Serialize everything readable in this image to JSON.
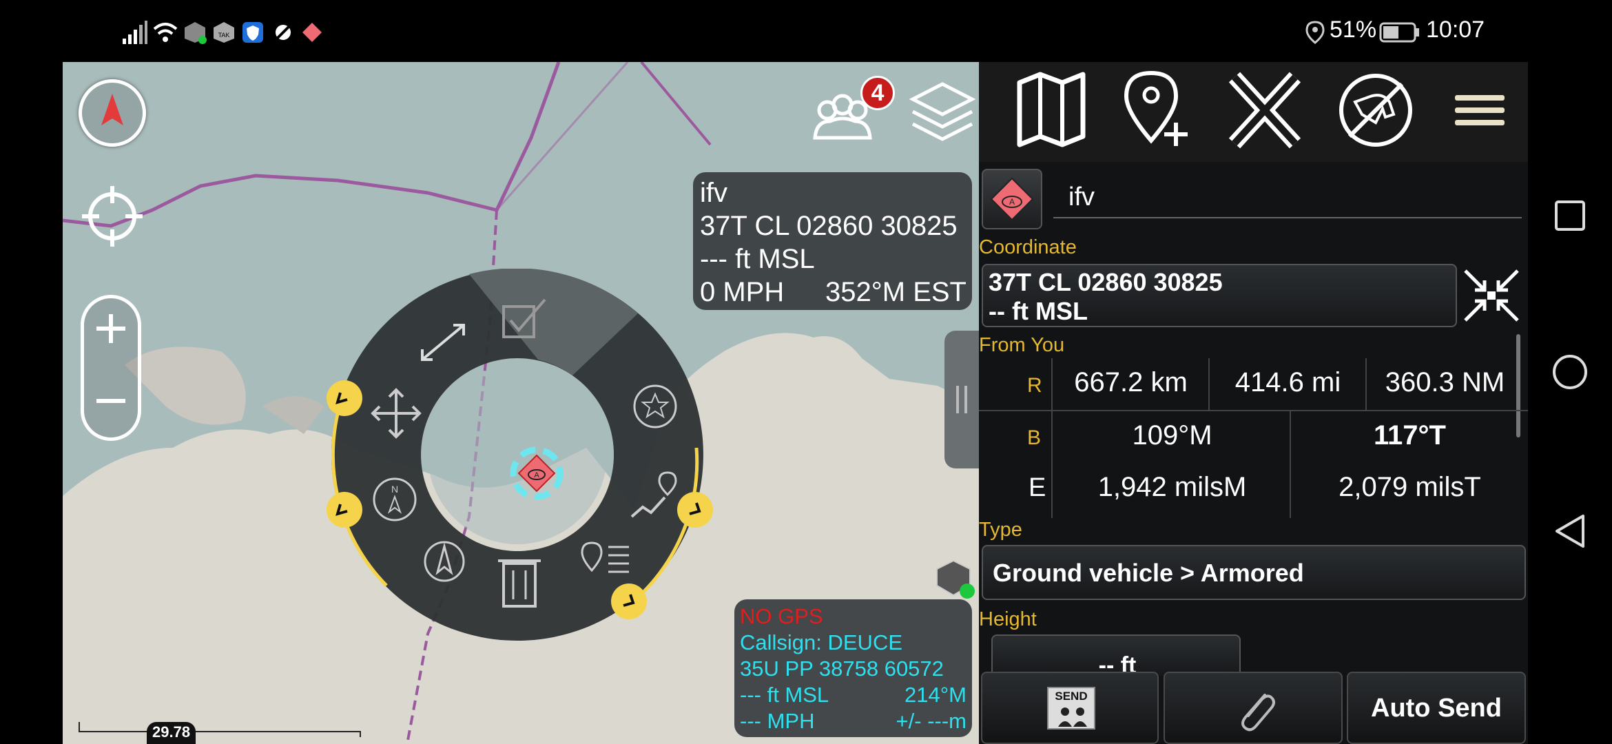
{
  "status_bar": {
    "battery_pct": "51%",
    "time": "10:07"
  },
  "map": {
    "selected_info": {
      "name": "ifv",
      "coordinate": "37T CL 02860 30825",
      "altitude": "--- ft MSL",
      "speed": "0 MPH",
      "course": "352°M EST"
    },
    "self_info": {
      "gps_status": "NO GPS",
      "callsign": "Callsign: DEUCE",
      "coordinate": "35U  PP  38758  60572",
      "altitude": "--- ft MSL",
      "heading": "214°M",
      "speed": "--- MPH",
      "accuracy": "+/- ---m"
    },
    "contacts_badge": "4",
    "scale_label": "29.78 km"
  },
  "toolbar": {
    "icons": [
      "map-icon",
      "add-pin-icon",
      "close-x-icon",
      "no-dog-icon",
      "hamburger-menu-icon"
    ]
  },
  "details": {
    "name_value": "ifv",
    "coordinate_label": "Coordinate",
    "coordinate_line1": "37T CL 02860 30825",
    "coordinate_line2": "-- ft MSL",
    "from_you_label": "From You",
    "range_label": "R",
    "range_km": "667.2 km",
    "range_mi": "414.6 mi",
    "range_nm": "360.3 NM",
    "bearing_label": "B",
    "bearing_mag": "109°M",
    "bearing_true": "117°T",
    "elev_label": "E",
    "mils_mag": "1,942 milsM",
    "mils_true": "2,079 milsT",
    "type_label": "Type",
    "type_value": "Ground vehicle > Armored",
    "height_label": "Height",
    "height_value": "-- ft",
    "send_label": "SEND",
    "auto_send_label": "Auto Send"
  },
  "colors": {
    "accent_yellow": "#e6b830",
    "hostile_red": "#ef6b73",
    "self_cyan": "#2ee0ee"
  }
}
